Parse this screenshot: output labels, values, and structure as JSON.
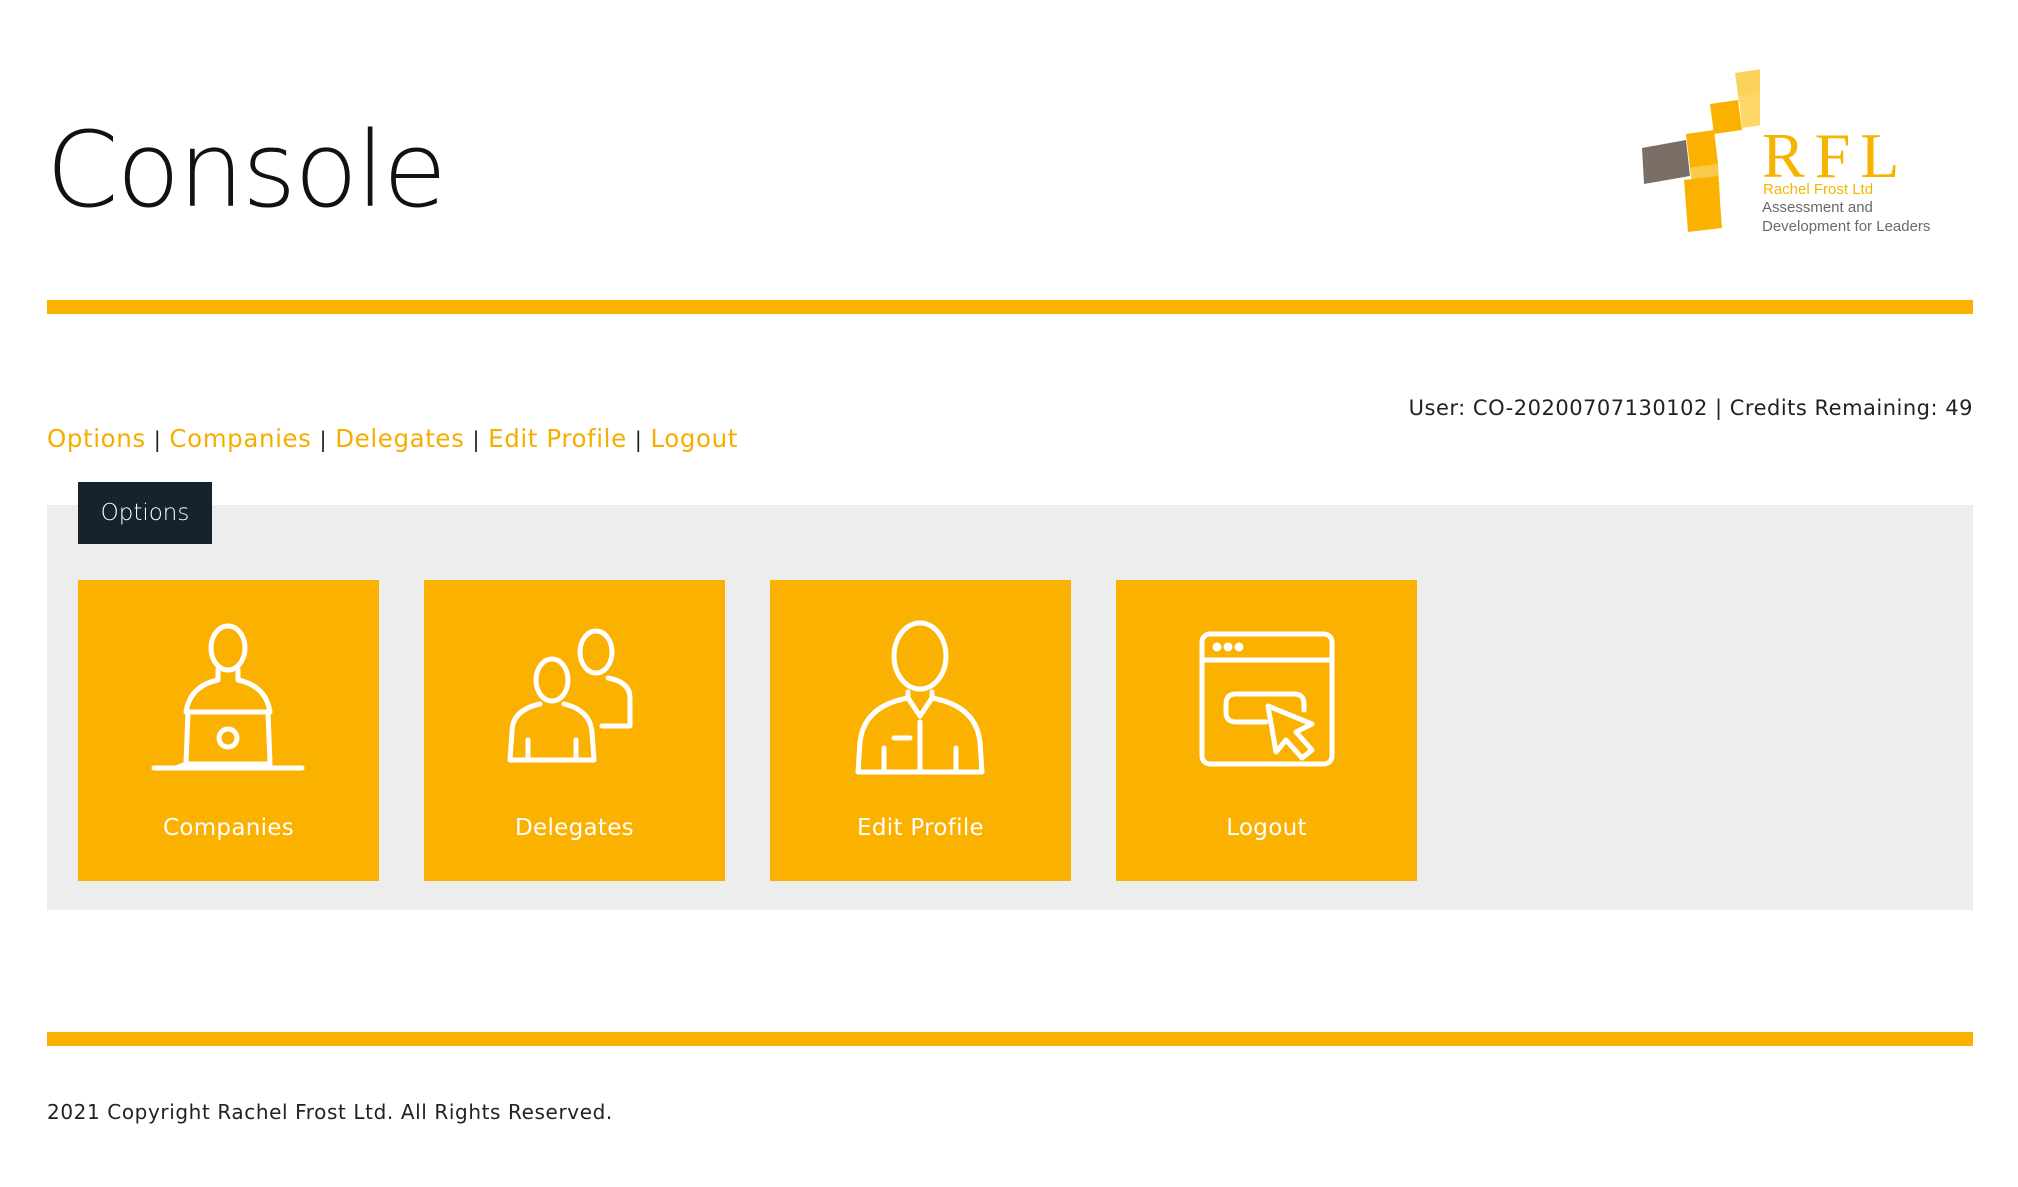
{
  "header": {
    "title": "Console",
    "logo": {
      "letters": "RFL",
      "company": "Rachel Frost Ltd",
      "tagline_line1": "Assessment and",
      "tagline_line2": "Development for Leaders"
    }
  },
  "user_info": {
    "text": "User: CO-20200707130102 | Credits Remaining: 49"
  },
  "nav": {
    "items": [
      {
        "label": "Options"
      },
      {
        "label": "Companies"
      },
      {
        "label": "Delegates"
      },
      {
        "label": "Edit Profile"
      },
      {
        "label": "Logout"
      }
    ],
    "separator": "|"
  },
  "panel": {
    "tab_label": "Options",
    "tiles": [
      {
        "label": "Companies",
        "icon": "person-laptop-icon"
      },
      {
        "label": "Delegates",
        "icon": "two-people-icon"
      },
      {
        "label": "Edit Profile",
        "icon": "person-suit-icon"
      },
      {
        "label": "Logout",
        "icon": "browser-cursor-icon"
      }
    ]
  },
  "footer": {
    "copyright": "2021 Copyright Rachel Frost Ltd. All Rights Reserved."
  },
  "colors": {
    "accent": "#fbb100",
    "tab_dark": "#16222c",
    "panel_bg": "#ededed",
    "logo_grey": "#7a6e66"
  }
}
